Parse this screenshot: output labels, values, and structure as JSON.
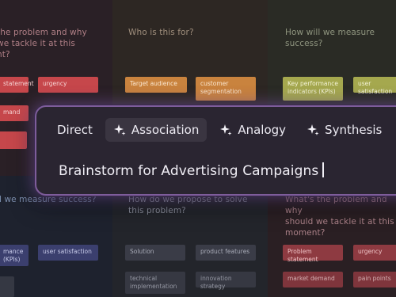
{
  "board": {
    "q_top_left": [
      "the problem and why",
      "we tackle it at this",
      "nt?"
    ],
    "q_top_center": "Who is this for?",
    "q_top_right": "How will we measure success?",
    "q_bot_left": "ll we measure success?",
    "q_bot_center": [
      "How do we propose to solve",
      "this problem?"
    ],
    "q_bot_right": [
      "What's the problem and why",
      "should we tackle it at this",
      "moment?"
    ],
    "stickies": {
      "tl_statement": "statement",
      "tl_urgency": "urgency",
      "tl_demand": "mand",
      "tc_target": "Target audience",
      "tc_customer": [
        "customer",
        "segmentation"
      ],
      "tr_kpi": [
        "Key performance",
        "indicators (KPIs)"
      ],
      "tr_user_sat": "user satisfaction",
      "bl_mance": [
        "mance",
        "(KPIs)"
      ],
      "bl_user_sat": "user satisfaction",
      "bl_dim": "",
      "bc_solution": "Solution",
      "bc_product": "product features",
      "bc_technical": [
        "technical",
        "implementation"
      ],
      "bc_innovation": "innovation strategy",
      "br_problem": "Problem statement",
      "br_urgency": "urgency",
      "br_market": "market demand",
      "br_pain": "pain points"
    }
  },
  "composer": {
    "tabs": [
      {
        "label": "Direct",
        "icon": "none",
        "active": false
      },
      {
        "label": "Association",
        "icon": "sparkle-icon",
        "active": true
      },
      {
        "label": "Analogy",
        "icon": "sparkle-icon",
        "active": false
      },
      {
        "label": "Synthesis",
        "icon": "sparkle-icon",
        "active": false
      }
    ],
    "prompt_text": "Brainstorm for Advertising Campaigns"
  }
}
